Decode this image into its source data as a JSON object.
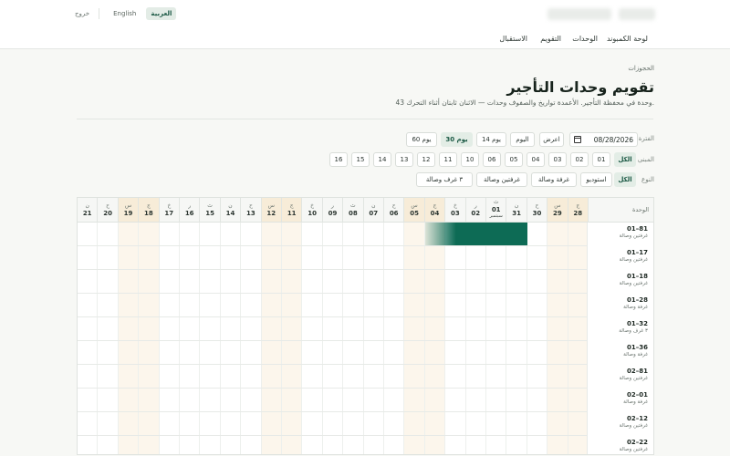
{
  "topbar": {
    "logout": "خروج",
    "lang_english": "English",
    "lang_arabic": "العربية"
  },
  "nav": {
    "items": [
      "لوحة الكمبوند",
      "الوحدات",
      "التقويم",
      "الاستقبال"
    ]
  },
  "page": {
    "breadcrumb": "الحجوزات",
    "title": "تقويم وحدات التأجير",
    "subtitle": "43 وحدة في محفظة التأجير. الأعمدة تواريخ والصفوف وحدات — الاثنان ثابتان أثناء التحرك."
  },
  "filters": {
    "period": {
      "label": "الفترة",
      "date_value": "08/28/2026",
      "show": "اعرض",
      "today": "اليوم",
      "ranges": [
        "14 يوم",
        "30 يوم",
        "60 يوم"
      ],
      "active_range": "30 يوم"
    },
    "building": {
      "label": "المبنى",
      "all": "الكل",
      "options": [
        "01",
        "02",
        "03",
        "04",
        "05",
        "06",
        "10",
        "11",
        "12",
        "13",
        "14",
        "15",
        "16"
      ]
    },
    "type": {
      "label": "النوع",
      "all": "الكل",
      "options": [
        "استوديو",
        "غرفة وصالة",
        "غرفتين وصالة",
        "٣ غرف وصالة"
      ]
    }
  },
  "calendar": {
    "unit_header": "الوحدة",
    "days": [
      {
        "name": "ج",
        "num": "28",
        "weekend": true
      },
      {
        "name": "س",
        "num": "29",
        "weekend": true
      },
      {
        "name": "ح",
        "num": "30",
        "weekend": false
      },
      {
        "name": "ن",
        "num": "31",
        "weekend": false
      },
      {
        "name": "ث",
        "num": "01",
        "month": "سبتمبر",
        "weekend": false
      },
      {
        "name": "ر",
        "num": "02",
        "weekend": false
      },
      {
        "name": "خ",
        "num": "03",
        "weekend": false
      },
      {
        "name": "ج",
        "num": "04",
        "weekend": true
      },
      {
        "name": "س",
        "num": "05",
        "weekend": true
      },
      {
        "name": "ح",
        "num": "06",
        "weekend": false
      },
      {
        "name": "ن",
        "num": "07",
        "weekend": false
      },
      {
        "name": "ث",
        "num": "08",
        "weekend": false
      },
      {
        "name": "ر",
        "num": "09",
        "weekend": false
      },
      {
        "name": "خ",
        "num": "10",
        "weekend": false
      },
      {
        "name": "ج",
        "num": "11",
        "weekend": true
      },
      {
        "name": "س",
        "num": "12",
        "weekend": true
      },
      {
        "name": "ح",
        "num": "13",
        "weekend": false
      },
      {
        "name": "ن",
        "num": "14",
        "weekend": false
      },
      {
        "name": "ث",
        "num": "15",
        "weekend": false
      },
      {
        "name": "ر",
        "num": "16",
        "weekend": false
      },
      {
        "name": "خ",
        "num": "17",
        "weekend": false
      },
      {
        "name": "ج",
        "num": "18",
        "weekend": true
      },
      {
        "name": "س",
        "num": "19",
        "weekend": true
      },
      {
        "name": "ح",
        "num": "20",
        "weekend": false
      },
      {
        "name": "ن",
        "num": "21",
        "weekend": false
      }
    ],
    "units": [
      {
        "name": "01–81",
        "type": "غرفتين وصالة"
      },
      {
        "name": "01–17",
        "type": "غرفتين وصالة"
      },
      {
        "name": "01–18",
        "type": "غرفتين وصالة"
      },
      {
        "name": "01–28",
        "type": "غرفة وصالة"
      },
      {
        "name": "01–32",
        "type": "٣ غرف وصالة"
      },
      {
        "name": "01–36",
        "type": "غرفة وصالة"
      },
      {
        "name": "02–81",
        "type": "غرفتين وصالة"
      },
      {
        "name": "02–01",
        "type": "غرفة وصالة"
      },
      {
        "name": "02–12",
        "type": "غرفتين وصالة"
      },
      {
        "name": "02–22",
        "type": "غرفتين وصالة"
      }
    ],
    "colors": {
      "booking": "#0d6b55",
      "weekend_bg": "#fcf6ec",
      "weekend_header": "#f7ecd8"
    }
  }
}
